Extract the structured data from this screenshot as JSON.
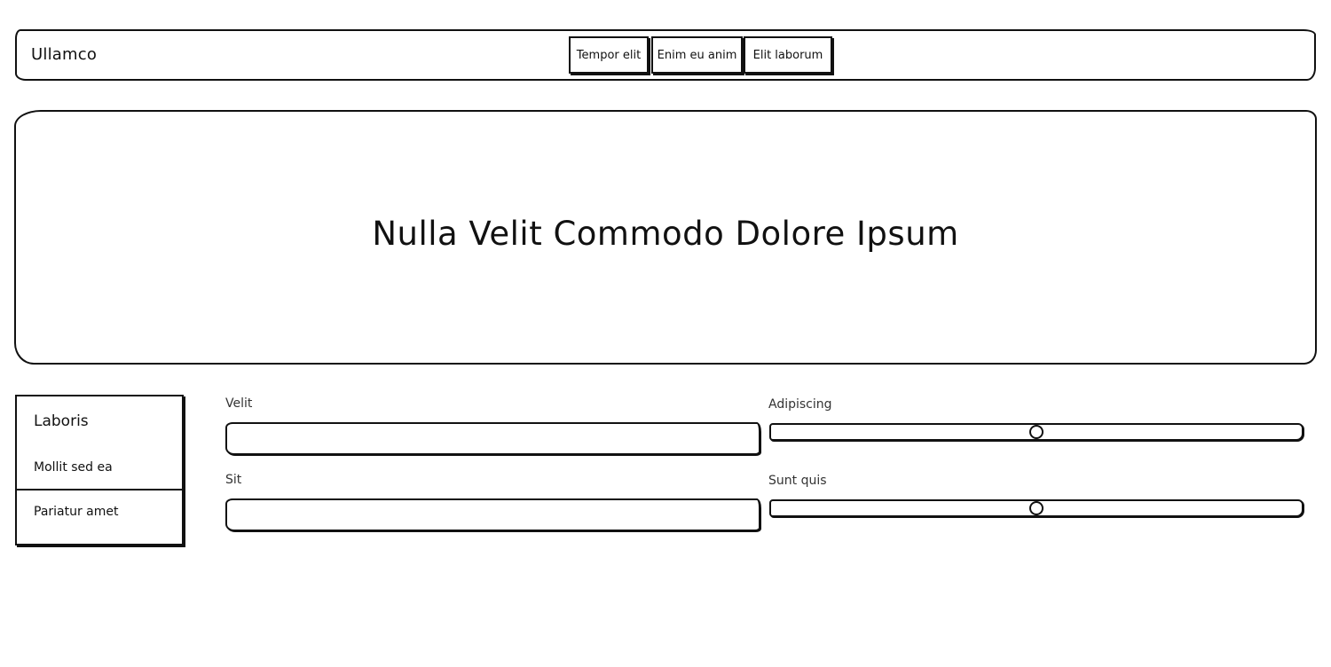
{
  "header": {
    "brand": "Ullamco",
    "nav": [
      {
        "label": "Tempor elit"
      },
      {
        "label": "Enim eu anim"
      },
      {
        "label": "Elit laborum"
      }
    ]
  },
  "hero": {
    "title": "Nulla Velit Commodo Dolore Ipsum"
  },
  "sidebar": {
    "title": "Laboris",
    "items": [
      {
        "label": "Mollit sed ea"
      },
      {
        "label": "Pariatur amet"
      }
    ]
  },
  "form": {
    "fields": [
      {
        "label": "Velit",
        "value": ""
      },
      {
        "label": "Sit",
        "value": ""
      }
    ],
    "sliders": [
      {
        "label": "Adipiscing",
        "value_fraction": 0.5
      },
      {
        "label": "Sunt quis",
        "value_fraction": 0.5
      }
    ]
  }
}
